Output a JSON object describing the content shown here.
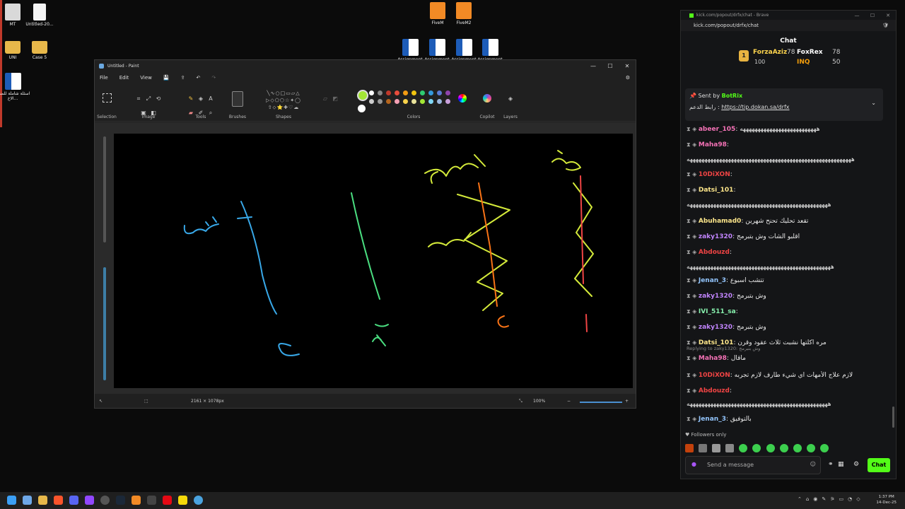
{
  "desktop": {
    "icons": [
      {
        "label": "MT",
        "kind": "gear"
      },
      {
        "label": "Untitled-20...",
        "kind": "doc"
      },
      {
        "label": "UNI",
        "kind": "folder"
      },
      {
        "label": "Case 5",
        "kind": "folder"
      },
      {
        "label": "اسئلة شاملة للمنهج الاخ...",
        "kind": "word"
      },
      {
        "label": "FiveM",
        "kind": "five"
      },
      {
        "label": "FiveM2",
        "kind": "five"
      },
      {
        "label": "Assignment",
        "kind": "word"
      },
      {
        "label": "Assignment",
        "kind": "word"
      },
      {
        "label": "Assignment",
        "kind": "word"
      },
      {
        "label": "Assignment",
        "kind": "word"
      }
    ]
  },
  "paint": {
    "title": "Untitled - Paint",
    "menu": [
      "File",
      "Edit",
      "View"
    ],
    "ribbon_groups": [
      "Selection",
      "Image",
      "Tools",
      "Brushes",
      "Shapes",
      "Colors",
      "Copilot",
      "Layers"
    ],
    "canvas_size": "2161 × 1078px",
    "zoom": "100%",
    "primary_color": "#a3e635",
    "secondary_color": "#ffffff",
    "palette": [
      "#ffffff",
      "#888888",
      "#c0392b",
      "#e74c3c",
      "#f39c12",
      "#f1c40f",
      "#2ecc71",
      "#3498db",
      "#5b7bd5",
      "#8e44ad",
      "#cccccc",
      "#999999",
      "#b5651d",
      "#f5a0b4",
      "#f8d24a",
      "#e8e29a",
      "#a3e635",
      "#7fd6f5",
      "#9bb7e0",
      "#c9a0dc"
    ]
  },
  "browser": {
    "title": "kick.com/popout/drfx/chat - Brave",
    "url": "kick.com/popout/drfx/chat",
    "chat_header": "Chat",
    "leaderboard": [
      {
        "rank": "1",
        "name": "ForzaAziz",
        "score": "78",
        "score2": "100"
      },
      {
        "name": "FoxRex",
        "score": "78"
      },
      {
        "name": "INQ",
        "score": "50"
      }
    ],
    "pinned": {
      "sent_by_label": "Sent by",
      "sender": "BotRix",
      "text_prefix": "رابط الدعم :",
      "link": "https://tip.dokan.sa/drfx"
    },
    "messages": [
      {
        "user": "abeer_105",
        "color": "#f472b6",
        "text": "ههههههههههههههههههههههههههه"
      },
      {
        "user": "Maha98",
        "color": "#f472b6",
        "text": ""
      },
      {
        "user": "",
        "color": "#ddd",
        "text": "ههههههههههههههههههههههههههههههههههههههههههههههههههههههههه"
      },
      {
        "user": "10DiXON",
        "color": "#ef4444",
        "text": ""
      },
      {
        "user": "Datsi_101",
        "color": "#fde68a",
        "text": ""
      },
      {
        "user": "",
        "color": "#ddd",
        "text": "ههههههههههههههههههههههههههههههههههههههههههههههههه"
      },
      {
        "user": "Abuhamad0",
        "color": "#fde68a",
        "text": "تقعد تحليك تحنح شهرين"
      },
      {
        "user": "zaky1320",
        "color": "#c084fc",
        "text": "اقلبو الشات وش بتبرمج"
      },
      {
        "user": "Abdouzd",
        "color": "#ef4444",
        "text": ""
      },
      {
        "user": "",
        "color": "#ddd",
        "text": "هههههههههههههههههههههههههههههههههههههههههههههههههه"
      },
      {
        "user": "Jenan_3",
        "color": "#93c5fd",
        "text": "تتشب اسبوع"
      },
      {
        "user": "zaky1320",
        "color": "#c084fc",
        "text": "وش بتبرمج"
      },
      {
        "user": "IVI_511_sa",
        "color": "#86efac",
        "text": ""
      },
      {
        "user": "zaky1320",
        "color": "#c084fc",
        "text": "وش بتبرمج"
      },
      {
        "user": "Datsi_101",
        "color": "#fde68a",
        "text": "مره اكلتها نشبت ثلاث عقود وقرن"
      },
      {
        "user": "Maha98",
        "color": "#f472b6",
        "text": "ماقال",
        "reply": "Replying to zaky1320: وش بتبرمج"
      },
      {
        "user": "10DiXON",
        "color": "#ef4444",
        "text": "لازم علاج الأمهات اي شيء طارف لازم تجربه"
      },
      {
        "user": "Abdouzd",
        "color": "#ef4444",
        "text": ""
      },
      {
        "user": "",
        "color": "#ddd",
        "text": "ههههههههههههههههههههههههههههههههههههههههههههههههه"
      },
      {
        "user": "Jenan_3",
        "color": "#93c5fd",
        "text": "بالتوفيق"
      }
    ],
    "followers_only": "Followers only",
    "input_placeholder": "Send a message",
    "chat_button": "Chat"
  },
  "taskbar": {
    "time": "1:37 PM",
    "date": "14-Dec-25"
  }
}
